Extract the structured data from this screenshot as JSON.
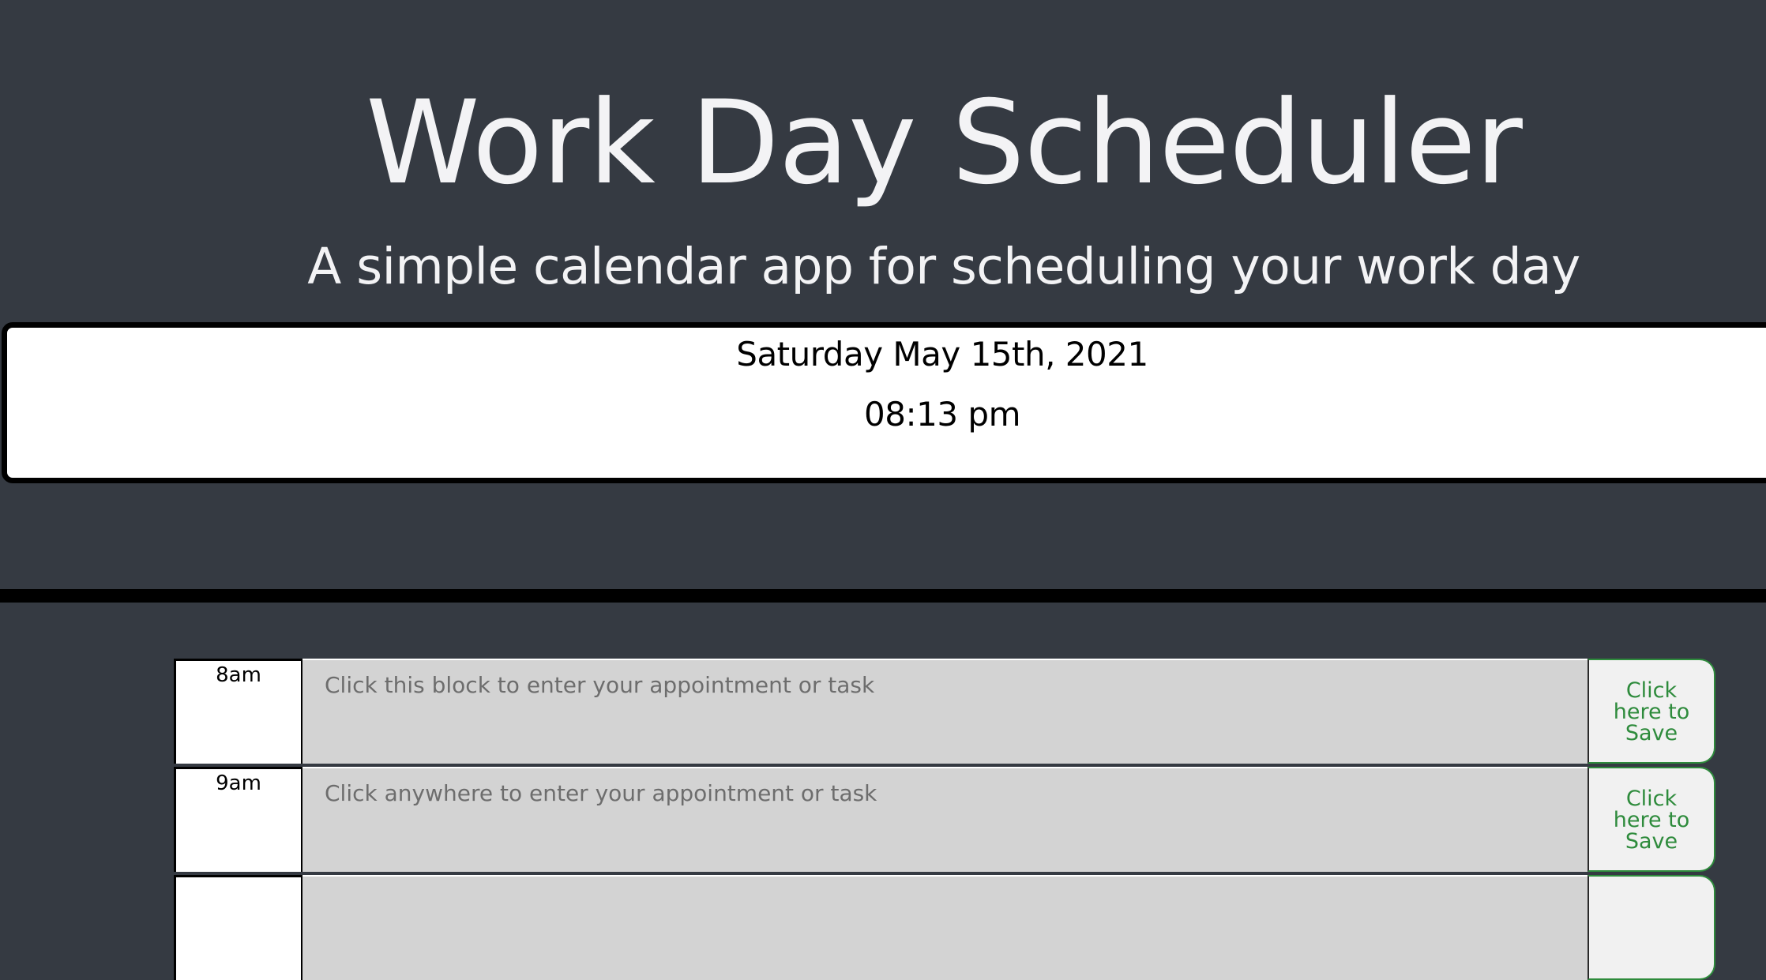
{
  "header": {
    "title": "Work Day Scheduler",
    "subtitle": "A simple calendar app for scheduling your work day"
  },
  "current": {
    "date": "Saturday May 15th, 2021",
    "time": "08:13 pm"
  },
  "rows": [
    {
      "hour": "8am",
      "placeholder": "Click this block to enter your appointment or task",
      "save_line1": "Click",
      "save_line2": "here to",
      "save_line3": "Save"
    },
    {
      "hour": "9am",
      "placeholder": "Click anywhere to enter your appointment or task",
      "save_line1": "Click",
      "save_line2": "here to",
      "save_line3": "Save"
    },
    {
      "hour": "",
      "placeholder": "",
      "save_line1": "",
      "save_line2": "",
      "save_line3": ""
    }
  ],
  "colors": {
    "background": "#353a42",
    "past_block": "#d3d3d3",
    "save_text": "#2e8b3c"
  }
}
